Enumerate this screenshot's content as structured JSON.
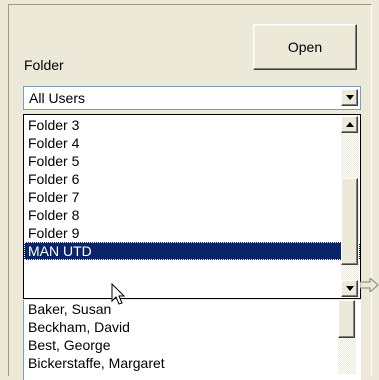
{
  "open_button": {
    "label": "Open"
  },
  "folder": {
    "label": "Folder",
    "selected": "All Users"
  },
  "dropdown": {
    "items": [
      {
        "label": "Folder 3",
        "selected": false
      },
      {
        "label": "Folder 4",
        "selected": false
      },
      {
        "label": "Folder 5",
        "selected": false
      },
      {
        "label": "Folder 6",
        "selected": false
      },
      {
        "label": "Folder 7",
        "selected": false
      },
      {
        "label": "Folder 8",
        "selected": false
      },
      {
        "label": "Folder 9",
        "selected": false
      },
      {
        "label": "MAN UTD",
        "selected": true
      }
    ]
  },
  "users_list": {
    "items": [
      "Baker, Susan",
      "Beckham, David",
      "Best, George",
      "Bickerstaffe, Margaret"
    ]
  },
  "colors": {
    "selection": "#0a246a",
    "window": "#ece9d8"
  }
}
